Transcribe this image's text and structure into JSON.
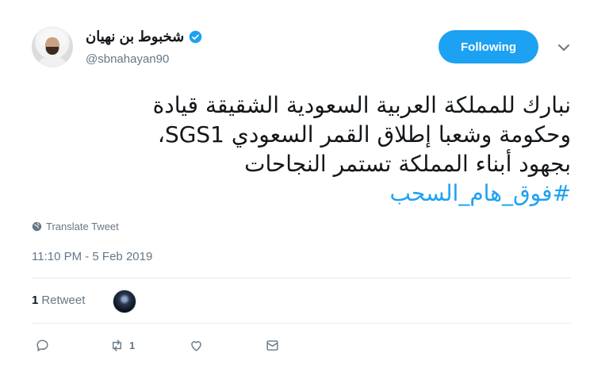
{
  "user": {
    "display_name": "شخبوط بن نهيان",
    "handle": "@sbnahayan90",
    "verified_icon": "verified-badge-icon"
  },
  "follow_button": {
    "label": "Following"
  },
  "tweet": {
    "lines": [
      "نبارك للمملكة العربية السعودية الشقيقة قيادة",
      "وحكومة وشعبا إطلاق القمر السعودي SGS1،",
      "بجهود أبناء المملكة  تستمر النجاحات"
    ],
    "hashtag": "#فوق_هام_السحب"
  },
  "translate_label": "Translate Tweet",
  "timestamp": "11:10 PM - 5 Feb 2019",
  "stats": {
    "retweet_count": "1",
    "retweet_label": "Retweet"
  },
  "actions": {
    "reply_icon": "reply-icon",
    "retweet_icon": "retweet-icon",
    "retweet_count": "1",
    "like_icon": "heart-icon",
    "dm_icon": "envelope-icon"
  },
  "colors": {
    "accent": "#1da1f2",
    "secondary_text": "#657786",
    "divider": "#e6ecf0"
  }
}
